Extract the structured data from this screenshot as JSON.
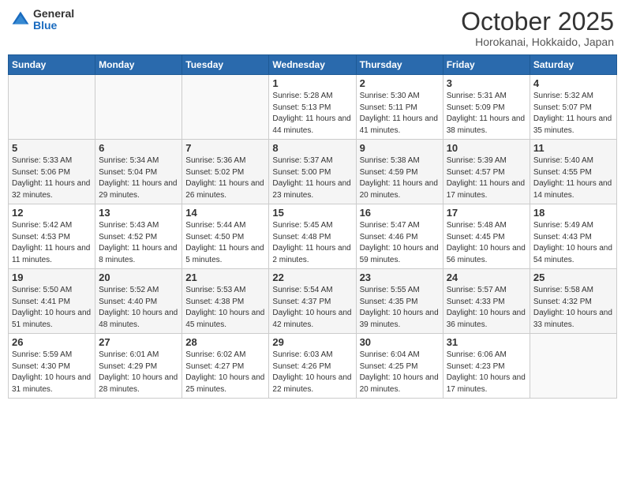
{
  "header": {
    "logo_general": "General",
    "logo_blue": "Blue",
    "month_title": "October 2025",
    "location": "Horokanai, Hokkaido, Japan"
  },
  "weekdays": [
    "Sunday",
    "Monday",
    "Tuesday",
    "Wednesday",
    "Thursday",
    "Friday",
    "Saturday"
  ],
  "weeks": [
    [
      {
        "day": "",
        "info": ""
      },
      {
        "day": "",
        "info": ""
      },
      {
        "day": "",
        "info": ""
      },
      {
        "day": "1",
        "info": "Sunrise: 5:28 AM\nSunset: 5:13 PM\nDaylight: 11 hours\nand 44 minutes."
      },
      {
        "day": "2",
        "info": "Sunrise: 5:30 AM\nSunset: 5:11 PM\nDaylight: 11 hours\nand 41 minutes."
      },
      {
        "day": "3",
        "info": "Sunrise: 5:31 AM\nSunset: 5:09 PM\nDaylight: 11 hours\nand 38 minutes."
      },
      {
        "day": "4",
        "info": "Sunrise: 5:32 AM\nSunset: 5:07 PM\nDaylight: 11 hours\nand 35 minutes."
      }
    ],
    [
      {
        "day": "5",
        "info": "Sunrise: 5:33 AM\nSunset: 5:06 PM\nDaylight: 11 hours\nand 32 minutes."
      },
      {
        "day": "6",
        "info": "Sunrise: 5:34 AM\nSunset: 5:04 PM\nDaylight: 11 hours\nand 29 minutes."
      },
      {
        "day": "7",
        "info": "Sunrise: 5:36 AM\nSunset: 5:02 PM\nDaylight: 11 hours\nand 26 minutes."
      },
      {
        "day": "8",
        "info": "Sunrise: 5:37 AM\nSunset: 5:00 PM\nDaylight: 11 hours\nand 23 minutes."
      },
      {
        "day": "9",
        "info": "Sunrise: 5:38 AM\nSunset: 4:59 PM\nDaylight: 11 hours\nand 20 minutes."
      },
      {
        "day": "10",
        "info": "Sunrise: 5:39 AM\nSunset: 4:57 PM\nDaylight: 11 hours\nand 17 minutes."
      },
      {
        "day": "11",
        "info": "Sunrise: 5:40 AM\nSunset: 4:55 PM\nDaylight: 11 hours\nand 14 minutes."
      }
    ],
    [
      {
        "day": "12",
        "info": "Sunrise: 5:42 AM\nSunset: 4:53 PM\nDaylight: 11 hours\nand 11 minutes."
      },
      {
        "day": "13",
        "info": "Sunrise: 5:43 AM\nSunset: 4:52 PM\nDaylight: 11 hours\nand 8 minutes."
      },
      {
        "day": "14",
        "info": "Sunrise: 5:44 AM\nSunset: 4:50 PM\nDaylight: 11 hours\nand 5 minutes."
      },
      {
        "day": "15",
        "info": "Sunrise: 5:45 AM\nSunset: 4:48 PM\nDaylight: 11 hours\nand 2 minutes."
      },
      {
        "day": "16",
        "info": "Sunrise: 5:47 AM\nSunset: 4:46 PM\nDaylight: 10 hours\nand 59 minutes."
      },
      {
        "day": "17",
        "info": "Sunrise: 5:48 AM\nSunset: 4:45 PM\nDaylight: 10 hours\nand 56 minutes."
      },
      {
        "day": "18",
        "info": "Sunrise: 5:49 AM\nSunset: 4:43 PM\nDaylight: 10 hours\nand 54 minutes."
      }
    ],
    [
      {
        "day": "19",
        "info": "Sunrise: 5:50 AM\nSunset: 4:41 PM\nDaylight: 10 hours\nand 51 minutes."
      },
      {
        "day": "20",
        "info": "Sunrise: 5:52 AM\nSunset: 4:40 PM\nDaylight: 10 hours\nand 48 minutes."
      },
      {
        "day": "21",
        "info": "Sunrise: 5:53 AM\nSunset: 4:38 PM\nDaylight: 10 hours\nand 45 minutes."
      },
      {
        "day": "22",
        "info": "Sunrise: 5:54 AM\nSunset: 4:37 PM\nDaylight: 10 hours\nand 42 minutes."
      },
      {
        "day": "23",
        "info": "Sunrise: 5:55 AM\nSunset: 4:35 PM\nDaylight: 10 hours\nand 39 minutes."
      },
      {
        "day": "24",
        "info": "Sunrise: 5:57 AM\nSunset: 4:33 PM\nDaylight: 10 hours\nand 36 minutes."
      },
      {
        "day": "25",
        "info": "Sunrise: 5:58 AM\nSunset: 4:32 PM\nDaylight: 10 hours\nand 33 minutes."
      }
    ],
    [
      {
        "day": "26",
        "info": "Sunrise: 5:59 AM\nSunset: 4:30 PM\nDaylight: 10 hours\nand 31 minutes."
      },
      {
        "day": "27",
        "info": "Sunrise: 6:01 AM\nSunset: 4:29 PM\nDaylight: 10 hours\nand 28 minutes."
      },
      {
        "day": "28",
        "info": "Sunrise: 6:02 AM\nSunset: 4:27 PM\nDaylight: 10 hours\nand 25 minutes."
      },
      {
        "day": "29",
        "info": "Sunrise: 6:03 AM\nSunset: 4:26 PM\nDaylight: 10 hours\nand 22 minutes."
      },
      {
        "day": "30",
        "info": "Sunrise: 6:04 AM\nSunset: 4:25 PM\nDaylight: 10 hours\nand 20 minutes."
      },
      {
        "day": "31",
        "info": "Sunrise: 6:06 AM\nSunset: 4:23 PM\nDaylight: 10 hours\nand 17 minutes."
      },
      {
        "day": "",
        "info": ""
      }
    ]
  ]
}
